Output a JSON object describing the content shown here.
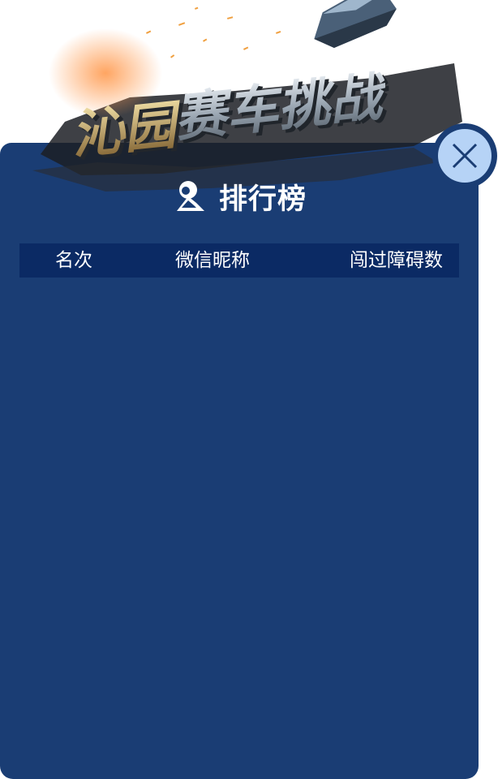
{
  "banner": {
    "logo_text": "沁园赛车挑战"
  },
  "leaderboard": {
    "title": "排行榜",
    "columns": {
      "rank": "名次",
      "nickname": "微信昵称",
      "obstacles": "闯过障碍数"
    },
    "rows": []
  },
  "icons": {
    "close": "close-icon",
    "title": "trophy-icon"
  },
  "colors": {
    "panel": "#1a3d74",
    "header_bar": "#0b2a64",
    "close_circle": "#b6d3f6"
  }
}
